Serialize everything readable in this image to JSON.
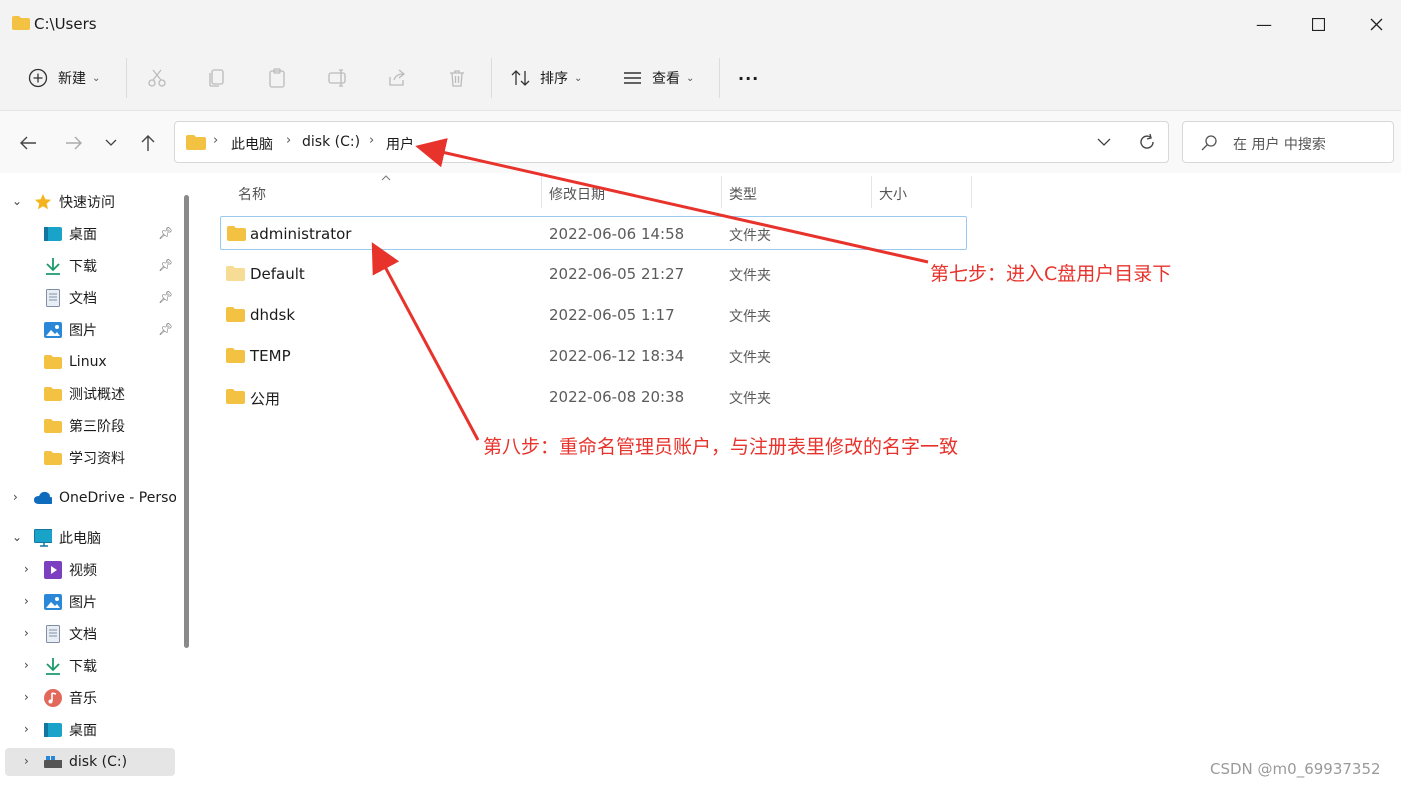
{
  "window": {
    "title": "C:\\Users",
    "controls": {
      "minimize": "—",
      "maximize": "☐",
      "close": "✕"
    }
  },
  "toolbar": {
    "new_label": "新建",
    "sort_label": "排序",
    "view_label": "查看",
    "more_label": "···"
  },
  "address": {
    "crumbs": [
      "此电脑",
      "disk (C:)",
      "用户"
    ],
    "search_placeholder": "在 用户 中搜索"
  },
  "sidebar": {
    "quick_access": "快速访问",
    "quick_items": [
      "桌面",
      "下载",
      "文档",
      "图片",
      "Linux",
      "测试概述",
      "第三阶段",
      "学习资料"
    ],
    "onedrive": "OneDrive - Perso",
    "this_pc": "此电脑",
    "pc_items": [
      "视频",
      "图片",
      "文档",
      "下载",
      "音乐",
      "桌面",
      "disk (C:)"
    ]
  },
  "columns": {
    "name": "名称",
    "modified": "修改日期",
    "type": "类型",
    "size": "大小"
  },
  "files": [
    {
      "name": "administrator",
      "modified": "2022-06-06 14:58",
      "type": "文件夹"
    },
    {
      "name": "Default",
      "modified": "2022-06-05 21:27",
      "type": "文件夹"
    },
    {
      "name": "dhdsk",
      "modified": "2022-06-05 1:17",
      "type": "文件夹"
    },
    {
      "name": "TEMP",
      "modified": "2022-06-12 18:34",
      "type": "文件夹"
    },
    {
      "name": "公用",
      "modified": "2022-06-08 20:38",
      "type": "文件夹"
    }
  ],
  "annotations": {
    "step7": "第七步：进入C盘用户目录下",
    "step8": "第八步：重命名管理员账户，与注册表里修改的名字一致"
  },
  "watermark": "CSDN @m0_69937352",
  "colors": {
    "accent": "#0067c0",
    "annotation": "#e8332c",
    "folder": "#f4c242"
  }
}
